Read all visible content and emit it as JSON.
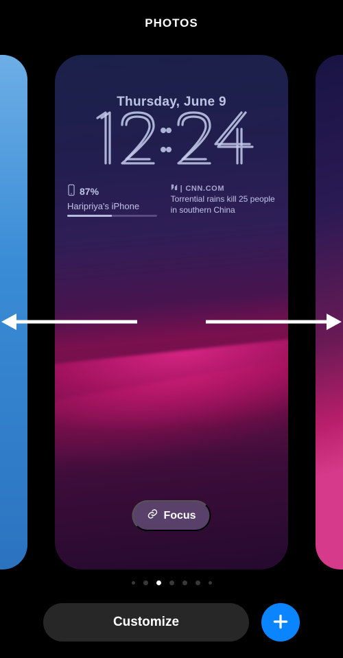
{
  "title": "PHOTOS",
  "lockscreen": {
    "date": "Thursday, June 9",
    "time": "12:24",
    "battery": {
      "percent_label": "87%",
      "device_name": "Haripriya's iPhone"
    },
    "news": {
      "source": "CNN.COM",
      "headline": "Torrential rains kill 25 people in southern China"
    },
    "focus_label": "Focus"
  },
  "pagination": {
    "count": 7,
    "active_index": 2
  },
  "buttons": {
    "customize": "Customize"
  },
  "icons": {
    "phone": "phone-icon",
    "apple_news": "apple-news-icon",
    "link": "link-icon",
    "plus": "plus-icon"
  }
}
